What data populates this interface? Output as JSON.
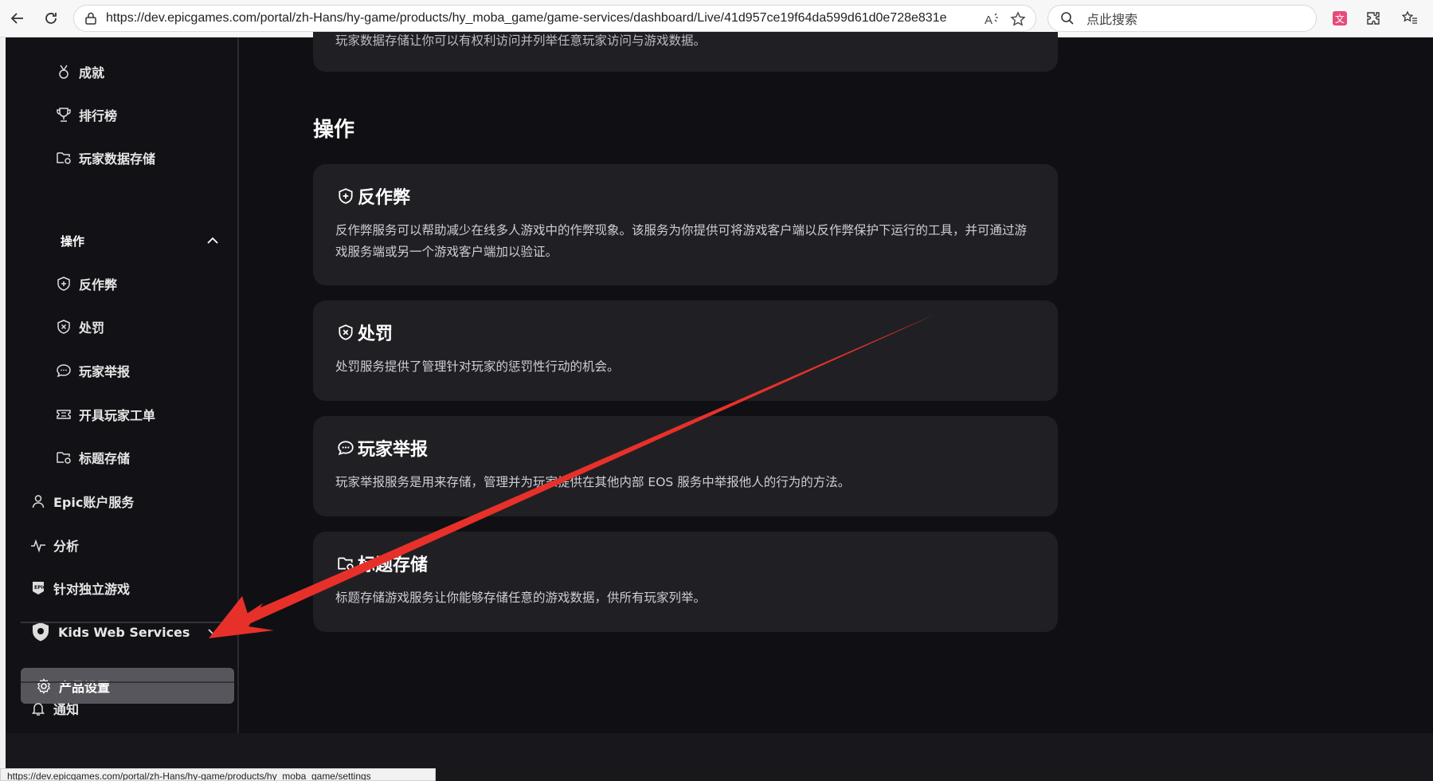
{
  "browser": {
    "url": "https://dev.epicgames.com/portal/zh-Hans/hy-game/products/hy_moba_game/game-services/dashboard/Live/41d957ce19f64da599d61d0e728e831e",
    "search_placeholder": "点此搜索",
    "status_url": "https://dev.epicgames.com/portal/zh-Hans/hy-game/products/hy_moba_game/settings"
  },
  "sidebar": {
    "items_top": [
      {
        "label": "成就",
        "icon": "medal-icon"
      },
      {
        "label": "排行榜",
        "icon": "trophy-icon"
      },
      {
        "label": "玩家数据存储",
        "icon": "folder-gear-icon"
      }
    ],
    "section": {
      "label": "操作",
      "icon": "chevron-up-icon"
    },
    "section_items": [
      {
        "label": "反作弊",
        "icon": "shield-plus-icon"
      },
      {
        "label": "处罚",
        "icon": "shield-x-icon"
      },
      {
        "label": "玩家举报",
        "icon": "chat-bubble-icon"
      },
      {
        "label": "开具玩家工单",
        "icon": "ticket-icon"
      },
      {
        "label": "标题存储",
        "icon": "folder-gear-icon"
      }
    ],
    "items_bottom": [
      {
        "label": "Epic账户服务",
        "icon": "user-icon"
      },
      {
        "label": "分析",
        "icon": "pulse-icon"
      },
      {
        "label": "针对独立游戏",
        "icon": "epic-logo-icon"
      },
      {
        "label": "Kids Web Services",
        "icon": "kws-shield-icon"
      }
    ],
    "settings": {
      "label": "产品设置",
      "icon": "gear-icon"
    },
    "notify": {
      "label": "通知",
      "icon": "bell-icon"
    }
  },
  "main": {
    "top_card_desc": "玩家数据存储让你可以有权利访问并列举任意玩家访问与游戏数据。",
    "section_title": "操作",
    "cards": [
      {
        "title": "反作弊",
        "icon": "shield-plus-icon",
        "desc": "反作弊服务可以帮助减少在线多人游戏中的作弊现象。该服务为你提供可将游戏客户端以反作弊保护下运行的工具，并可通过游戏服务端或另一个游戏客户端加以验证。"
      },
      {
        "title": "处罚",
        "icon": "shield-x-icon",
        "desc": "处罚服务提供了管理针对玩家的惩罚性行动的机会。"
      },
      {
        "title": "玩家举报",
        "icon": "chat-bubble-icon",
        "desc": "玩家举报服务是用来存储，管理并为玩家提供在其他内部 EOS 服务中举报他人的行为的方法。"
      },
      {
        "title": "标题存储",
        "icon": "folder-gear-icon",
        "desc": "标题存储游戏服务让你能够存储任意的游戏数据，供所有玩家列举。"
      }
    ]
  },
  "colors": {
    "accent_arrow": "#e8302a",
    "card_bg": "#202024",
    "sidebar_bg": "#121216"
  }
}
